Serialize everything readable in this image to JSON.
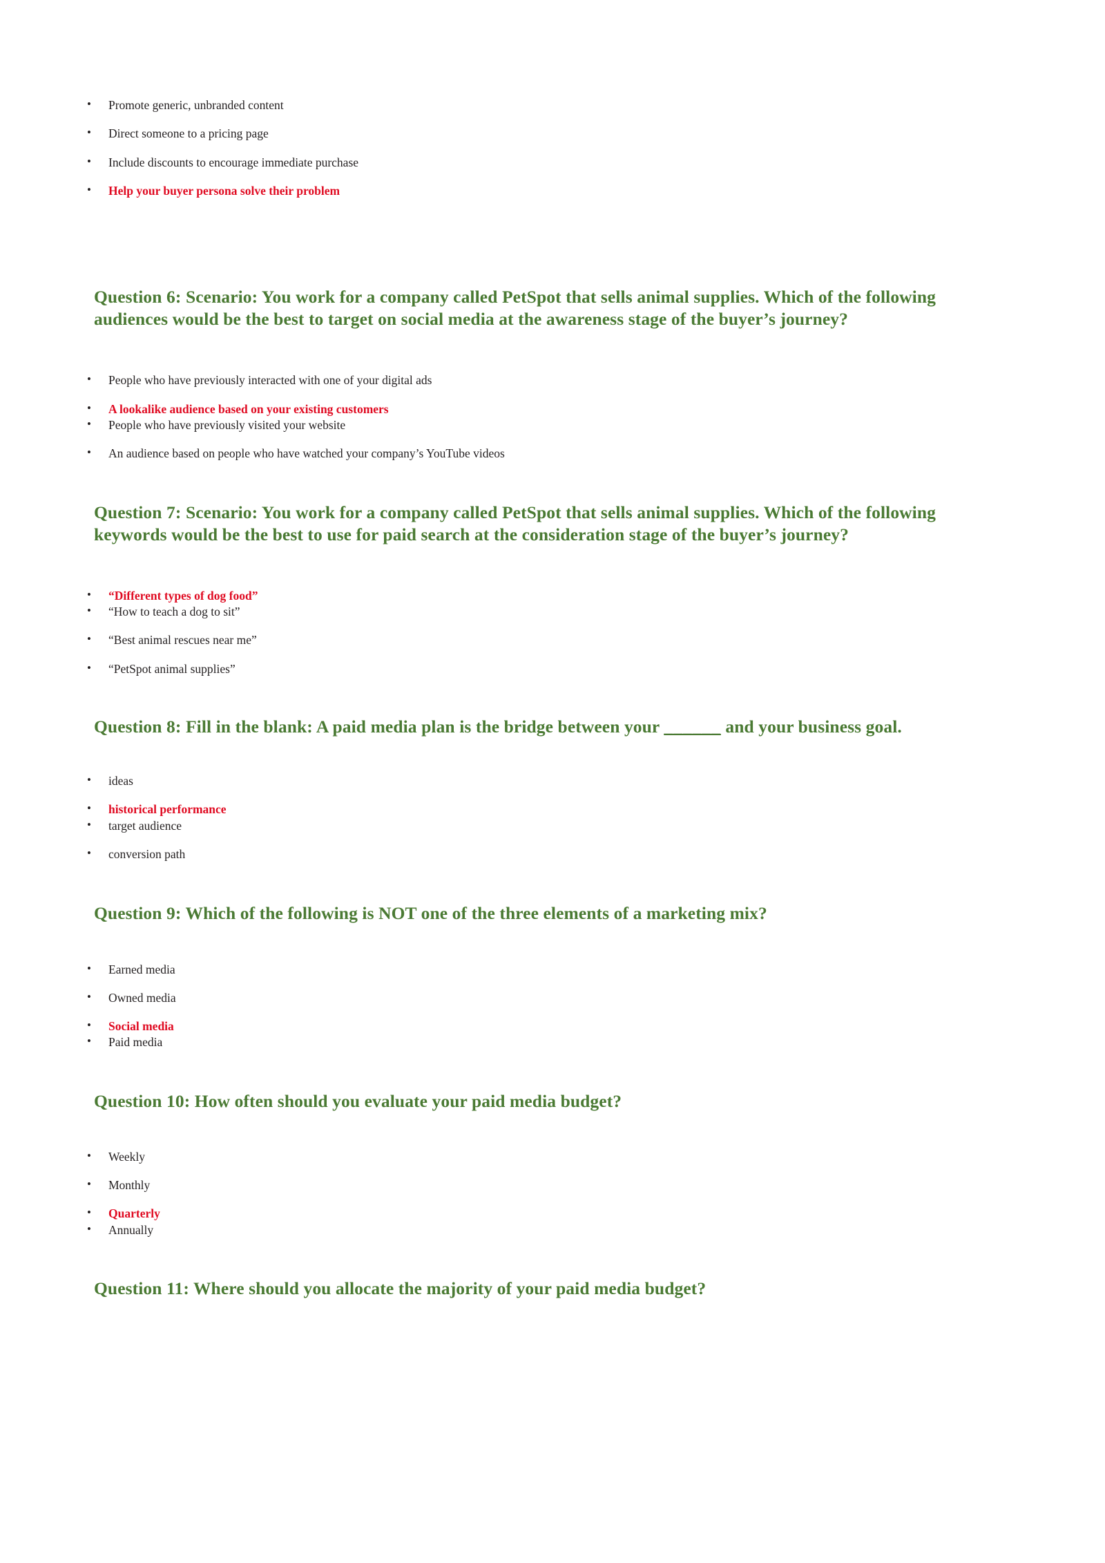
{
  "document": {
    "type": "quiz-answer-key",
    "colors": {
      "question_heading": "#4a7a33",
      "correct_answer": "#e00b22",
      "body_text": "#231f20",
      "page_background": "#ffffff"
    }
  },
  "top_answers": {
    "items": [
      {
        "text": "Promote generic, unbranded content",
        "correct": false
      },
      {
        "text": "Direct someone to a pricing page",
        "correct": false
      },
      {
        "text": "Include discounts to encourage immediate purchase",
        "correct": false
      },
      {
        "text": "Help your buyer persona solve their problem",
        "correct": true
      }
    ]
  },
  "questions": [
    {
      "id": "q6",
      "heading": "Question 6: Scenario: You work for a company called PetSpot that sells animal supplies. Which of the following audiences would be the best to target on social media at the awareness stage of the buyer’s journey?",
      "answers": [
        {
          "text": "People who have previously interacted with one of your digital ads",
          "correct": false
        },
        {
          "text": "A lookalike audience based on your existing customers",
          "correct": true
        },
        {
          "text": "People who have previously visited your website",
          "correct": false
        },
        {
          "text": "An audience based on people who have watched your company’s YouTube videos",
          "correct": false
        }
      ]
    },
    {
      "id": "q7",
      "heading": "Question 7: Scenario: You work for a company called PetSpot that sells animal supplies. Which of the following keywords would be the best to use for paid search at the consideration stage of the buyer’s journey?",
      "answers": [
        {
          "text": "“Different types of dog food”",
          "correct": true
        },
        {
          "text": "“How to teach a dog to sit”",
          "correct": false
        },
        {
          "text": "“Best animal rescues near me”",
          "correct": false
        },
        {
          "text": "“PetSpot animal supplies”",
          "correct": false
        }
      ]
    },
    {
      "id": "q8",
      "heading_before": "Question 8: Fill in the blank: A paid media plan is the bridge between your ",
      "heading_blank": "______",
      "heading_after": " and your business goal.",
      "answers": [
        {
          "text": "ideas",
          "correct": false
        },
        {
          "text": "historical performance",
          "correct": true
        },
        {
          "text": "target audience",
          "correct": false
        },
        {
          "text": "conversion path",
          "correct": false
        }
      ]
    },
    {
      "id": "q9",
      "heading": "Question 9: Which of the following is NOT one of the three elements of a marketing mix?",
      "answers": [
        {
          "text": "Earned media",
          "correct": false
        },
        {
          "text": "Owned media",
          "correct": false
        },
        {
          "text": "Social media",
          "correct": true
        },
        {
          "text": "Paid media",
          "correct": false
        }
      ]
    },
    {
      "id": "q10",
      "heading": "Question 10: How often should you evaluate your paid media budget?",
      "answers": [
        {
          "text": "Weekly",
          "correct": false
        },
        {
          "text": "Monthly",
          "correct": false
        },
        {
          "text": "Quarterly",
          "correct": true
        },
        {
          "text": "Annually",
          "correct": false
        }
      ]
    },
    {
      "id": "q11",
      "heading": "Question 11: Where should you allocate the majority of your paid media budget?",
      "answers": []
    }
  ]
}
